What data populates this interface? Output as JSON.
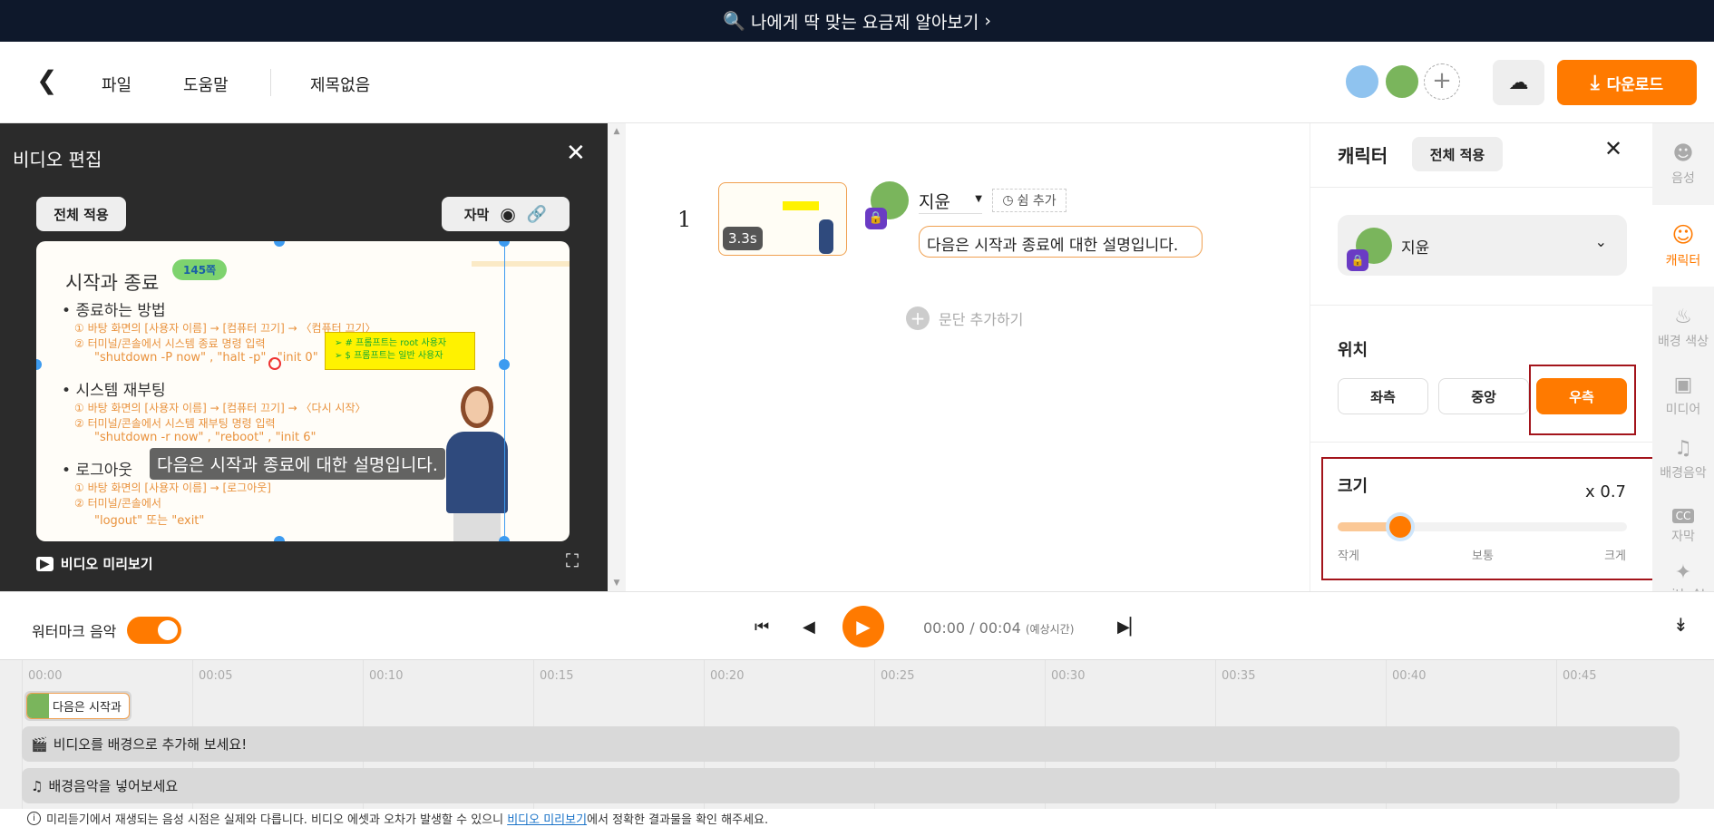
{
  "banner": {
    "text": "나에게 딱 맞는 요금제 알아보기",
    "icon": "search-icon"
  },
  "header": {
    "menu": [
      "파일",
      "도움말"
    ],
    "title": "제목없음",
    "download_label": "다운로드",
    "icons": [
      "back-arrow-icon",
      "upload-cloud-icon",
      "download-icon",
      "add-user-icon"
    ]
  },
  "video_edit": {
    "title": "비디오 편집",
    "apply_all": "전체 적용",
    "subtitle_label": "자막",
    "preview_label": "비디오 미리보기",
    "slide": {
      "title": "시작과 종료",
      "badge": "145쪽",
      "sections": [
        {
          "heading": "종료하는 방법",
          "lines": [
            "① 바탕 화면의 [사용자 이름] → [컴퓨터 끄기] → 〈컴퓨터 끄기〉",
            "② 터미널/콘솔에서 시스템 종료 명령 입력",
            "\"shutdown  -P now\" , \"halt  -p\" , \"init 0\""
          ]
        },
        {
          "heading": "시스템 재부팅",
          "lines": [
            "① 바탕 화면의 [사용자 이름] → [컴퓨터 끄기] → 〈다시 시작〉",
            "② 터미널/콘솔에서 시스템 재부팅 명령 입력",
            "\"shutdown -r now\" , \"reboot\" , \"init 6\""
          ]
        },
        {
          "heading": "로그아웃",
          "lines": [
            "① 바탕 화면의 [사용자 이름] → [로그아웃]",
            "② 터미널/콘솔에서",
            "\"logout\" 또는 \"exit\""
          ]
        }
      ],
      "note": [
        "➢  # 프롬프트는 root 사용자",
        "➢  $ 프롬프트는 일반 사용자"
      ],
      "caption": "다음은 시작과 종료에 대한 설명입니다."
    }
  },
  "script": {
    "scene_number": "1",
    "duration": "3.3s",
    "speaker": "지윤",
    "pause_label": "쉼 추가",
    "text": "다음은 시작과 종료에 대한 설명입니다.",
    "add_paragraph": "문단 추가하기"
  },
  "character_panel": {
    "title": "캐릭터",
    "apply_all": "전체 적용",
    "selected_character": "지윤",
    "position_label": "위치",
    "positions": [
      "좌측",
      "중앙",
      "우측"
    ],
    "selected_position": "우측",
    "size_label": "크기",
    "size_value": "x 0.7",
    "size_fraction": 0.18,
    "size_marks": [
      "작게",
      "보통",
      "크게"
    ]
  },
  "rail": [
    {
      "label": "음성",
      "icon": "voice-icon"
    },
    {
      "label": "캐릭터",
      "icon": "character-icon",
      "active": true
    },
    {
      "label": "배경 색상",
      "icon": "paint-bucket-icon"
    },
    {
      "label": "미디어",
      "icon": "media-icon"
    },
    {
      "label": "배경음악",
      "icon": "music-icon"
    },
    {
      "label": "자막",
      "icon": "cc-icon"
    },
    {
      "label": "with AI",
      "icon": "ai-wand-icon"
    }
  ],
  "controls": {
    "watermark_label": "워터마크 음악",
    "watermark_on": true,
    "time": "00:00 / 00:04",
    "time_note": "(예상시간)"
  },
  "timeline": {
    "ticks": [
      "00:00",
      "00:05",
      "00:10",
      "00:15",
      "00:20",
      "00:25",
      "00:30",
      "00:35",
      "00:40",
      "00:45"
    ],
    "clip_text": "다음은 시작과",
    "video_track": "비디오를 배경으로 추가해 보세요!",
    "music_track": "배경음악을 넣어보세요"
  },
  "footnote": {
    "before": "미리듣기에서 재생되는 음성 시점은 실제와 다릅니다. 비디오 에셋과 오차가 발생할 수 있으니 ",
    "link": "비디오 미리보기",
    "after": "에서 정확한 결과물을 확인 해주세요."
  },
  "colors": {
    "accent": "#ff7a00",
    "banner_bg": "#0e182b",
    "panel_dark": "#2b2b2b",
    "lock_purple": "#6a3bc4",
    "highlight_red": "#a3141b"
  }
}
